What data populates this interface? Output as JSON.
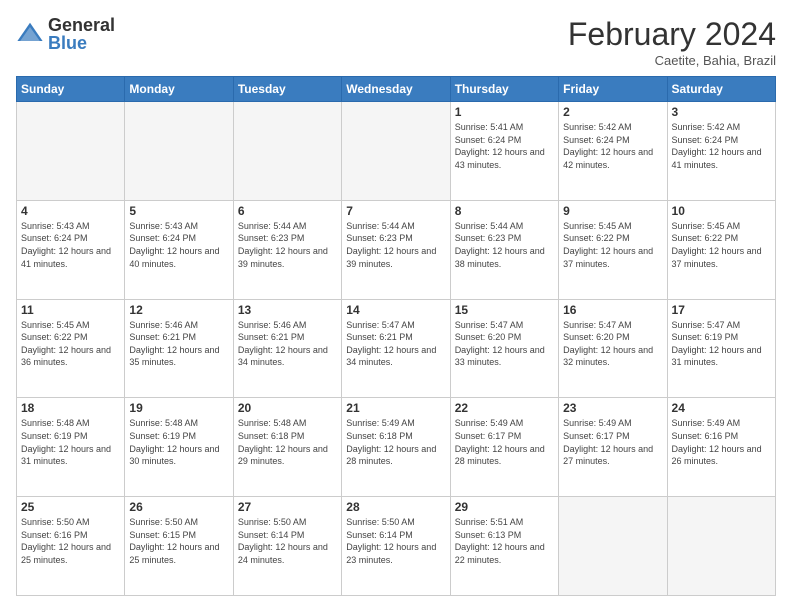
{
  "header": {
    "logo_general": "General",
    "logo_blue": "Blue",
    "month_title": "February 2024",
    "subtitle": "Caetite, Bahia, Brazil"
  },
  "days_of_week": [
    "Sunday",
    "Monday",
    "Tuesday",
    "Wednesday",
    "Thursday",
    "Friday",
    "Saturday"
  ],
  "weeks": [
    [
      {
        "day": "",
        "info": ""
      },
      {
        "day": "",
        "info": ""
      },
      {
        "day": "",
        "info": ""
      },
      {
        "day": "",
        "info": ""
      },
      {
        "day": "1",
        "info": "Sunrise: 5:41 AM\nSunset: 6:24 PM\nDaylight: 12 hours\nand 43 minutes."
      },
      {
        "day": "2",
        "info": "Sunrise: 5:42 AM\nSunset: 6:24 PM\nDaylight: 12 hours\nand 42 minutes."
      },
      {
        "day": "3",
        "info": "Sunrise: 5:42 AM\nSunset: 6:24 PM\nDaylight: 12 hours\nand 41 minutes."
      }
    ],
    [
      {
        "day": "4",
        "info": "Sunrise: 5:43 AM\nSunset: 6:24 PM\nDaylight: 12 hours\nand 41 minutes."
      },
      {
        "day": "5",
        "info": "Sunrise: 5:43 AM\nSunset: 6:24 PM\nDaylight: 12 hours\nand 40 minutes."
      },
      {
        "day": "6",
        "info": "Sunrise: 5:44 AM\nSunset: 6:23 PM\nDaylight: 12 hours\nand 39 minutes."
      },
      {
        "day": "7",
        "info": "Sunrise: 5:44 AM\nSunset: 6:23 PM\nDaylight: 12 hours\nand 39 minutes."
      },
      {
        "day": "8",
        "info": "Sunrise: 5:44 AM\nSunset: 6:23 PM\nDaylight: 12 hours\nand 38 minutes."
      },
      {
        "day": "9",
        "info": "Sunrise: 5:45 AM\nSunset: 6:22 PM\nDaylight: 12 hours\nand 37 minutes."
      },
      {
        "day": "10",
        "info": "Sunrise: 5:45 AM\nSunset: 6:22 PM\nDaylight: 12 hours\nand 37 minutes."
      }
    ],
    [
      {
        "day": "11",
        "info": "Sunrise: 5:45 AM\nSunset: 6:22 PM\nDaylight: 12 hours\nand 36 minutes."
      },
      {
        "day": "12",
        "info": "Sunrise: 5:46 AM\nSunset: 6:21 PM\nDaylight: 12 hours\nand 35 minutes."
      },
      {
        "day": "13",
        "info": "Sunrise: 5:46 AM\nSunset: 6:21 PM\nDaylight: 12 hours\nand 34 minutes."
      },
      {
        "day": "14",
        "info": "Sunrise: 5:47 AM\nSunset: 6:21 PM\nDaylight: 12 hours\nand 34 minutes."
      },
      {
        "day": "15",
        "info": "Sunrise: 5:47 AM\nSunset: 6:20 PM\nDaylight: 12 hours\nand 33 minutes."
      },
      {
        "day": "16",
        "info": "Sunrise: 5:47 AM\nSunset: 6:20 PM\nDaylight: 12 hours\nand 32 minutes."
      },
      {
        "day": "17",
        "info": "Sunrise: 5:47 AM\nSunset: 6:19 PM\nDaylight: 12 hours\nand 31 minutes."
      }
    ],
    [
      {
        "day": "18",
        "info": "Sunrise: 5:48 AM\nSunset: 6:19 PM\nDaylight: 12 hours\nand 31 minutes."
      },
      {
        "day": "19",
        "info": "Sunrise: 5:48 AM\nSunset: 6:19 PM\nDaylight: 12 hours\nand 30 minutes."
      },
      {
        "day": "20",
        "info": "Sunrise: 5:48 AM\nSunset: 6:18 PM\nDaylight: 12 hours\nand 29 minutes."
      },
      {
        "day": "21",
        "info": "Sunrise: 5:49 AM\nSunset: 6:18 PM\nDaylight: 12 hours\nand 28 minutes."
      },
      {
        "day": "22",
        "info": "Sunrise: 5:49 AM\nSunset: 6:17 PM\nDaylight: 12 hours\nand 28 minutes."
      },
      {
        "day": "23",
        "info": "Sunrise: 5:49 AM\nSunset: 6:17 PM\nDaylight: 12 hours\nand 27 minutes."
      },
      {
        "day": "24",
        "info": "Sunrise: 5:49 AM\nSunset: 6:16 PM\nDaylight: 12 hours\nand 26 minutes."
      }
    ],
    [
      {
        "day": "25",
        "info": "Sunrise: 5:50 AM\nSunset: 6:16 PM\nDaylight: 12 hours\nand 25 minutes."
      },
      {
        "day": "26",
        "info": "Sunrise: 5:50 AM\nSunset: 6:15 PM\nDaylight: 12 hours\nand 25 minutes."
      },
      {
        "day": "27",
        "info": "Sunrise: 5:50 AM\nSunset: 6:14 PM\nDaylight: 12 hours\nand 24 minutes."
      },
      {
        "day": "28",
        "info": "Sunrise: 5:50 AM\nSunset: 6:14 PM\nDaylight: 12 hours\nand 23 minutes."
      },
      {
        "day": "29",
        "info": "Sunrise: 5:51 AM\nSunset: 6:13 PM\nDaylight: 12 hours\nand 22 minutes."
      },
      {
        "day": "",
        "info": ""
      },
      {
        "day": "",
        "info": ""
      }
    ]
  ]
}
